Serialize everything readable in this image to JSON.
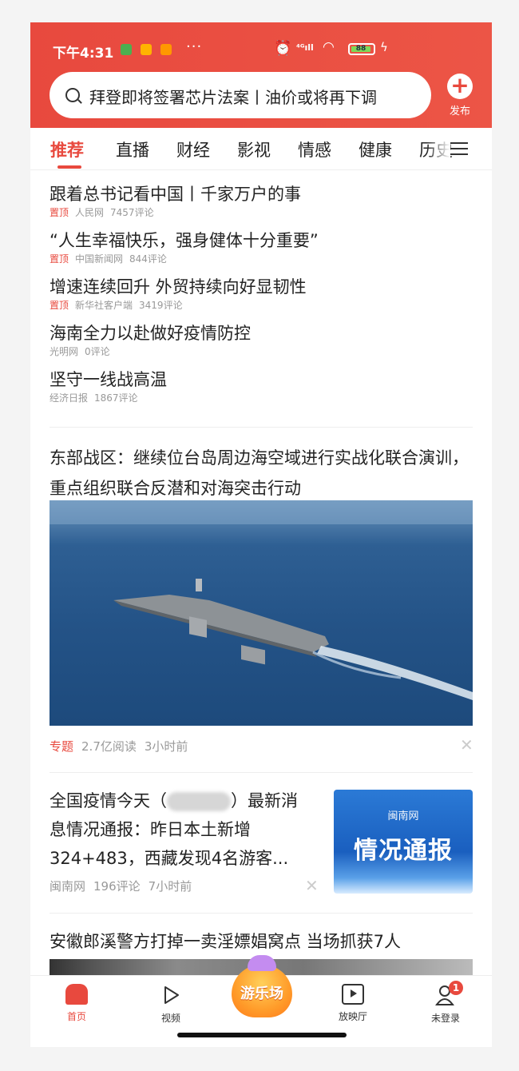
{
  "status_bar": {
    "time": "下午4:31",
    "dots": "···",
    "signal": "⁴ᴳıll",
    "battery": "88"
  },
  "search": {
    "placeholder": "拜登即将签署芯片法案丨油价或将再下调"
  },
  "publish": {
    "label": "发布"
  },
  "tabs": [
    "推荐",
    "直播",
    "财经",
    "影视",
    "情感",
    "健康",
    "历史"
  ],
  "headlines": [
    {
      "title": "跟着总书记看中国丨千家万户的事",
      "pin": "置顶",
      "source": "人民网",
      "comments": "7457评论"
    },
    {
      "title": "“人生幸福快乐，强身健体十分重要”",
      "pin": "置顶",
      "source": "中国新闻网",
      "comments": "844评论"
    },
    {
      "title": "增速连续回升 外贸持续向好显韧性",
      "pin": "置顶",
      "source": "新华社客户端",
      "comments": "3419评论"
    },
    {
      "title": "海南全力以赴做好疫情防控",
      "pin": "",
      "source": "光明网",
      "comments": "0评论"
    },
    {
      "title": "坚守一线战高温",
      "pin": "",
      "source": "经济日报",
      "comments": "1867评论"
    }
  ],
  "feature": {
    "title": "东部战区：继续位台岛周边海空域进行实战化联合演训，重点组织联合反潜和对海突击行动",
    "tag": "专题",
    "reads": "2.7亿阅读",
    "time": "3小时前"
  },
  "news2": {
    "title_before": "全国疫情今天（",
    "title_after": "）最新消息情况通报：昨日本土新增324+483，西藏发现4名游客...",
    "source": "闽南网",
    "comments": "196评论",
    "time": "7小时前",
    "thumb_logo": "闽南网",
    "thumb_text": "情况通报"
  },
  "news3": {
    "title": "安徽郎溪警方打掉一卖淫嫖娼窝点 当场抓获7人"
  },
  "bottom_nav": {
    "home": "首页",
    "video": "视频",
    "playground": "游乐场",
    "cinema": "放映厅",
    "login": "未登录",
    "badge": "1"
  },
  "colors": {
    "accent": "#e8493e"
  }
}
